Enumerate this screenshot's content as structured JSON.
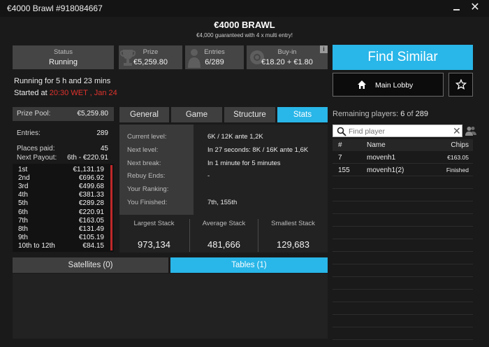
{
  "window": {
    "title": "€4000 Brawl #918084667"
  },
  "header": {
    "title": "€4000 BRAWL",
    "subtitle": "€4,000 guaranteed with 4 x multi entry!"
  },
  "tiles": [
    {
      "label": "Status",
      "value": "Running",
      "icon": ""
    },
    {
      "label": "Prize",
      "value": "€5,259.80",
      "icon": "trophy-icon"
    },
    {
      "label": "Entries",
      "value": "6/289",
      "icon": "person-icon"
    },
    {
      "label": "Buy-in",
      "value": "€18.20 + €1.80",
      "icon": "chip-icon"
    }
  ],
  "info_badge": "i",
  "status": {
    "running_prefix": "Running for",
    "running_value": "5 h and 23 mins",
    "started_prefix": "Started at",
    "started_value": "20:30 WET , Jan 24"
  },
  "actions": {
    "find_similar": "Find Similar",
    "main_lobby": "Main Lobby"
  },
  "players": {
    "remaining_label": "Remaining players:",
    "remaining_count": "6",
    "remaining_of": "of",
    "remaining_total": "289",
    "search_placeholder": "Find player",
    "columns": [
      "#",
      "Name",
      "Chips"
    ],
    "rows": [
      {
        "rank": "7",
        "name": "movenh1",
        "chips": "€163.05"
      },
      {
        "rank": "155",
        "name": "movenh1(2)",
        "chips": "Finished"
      }
    ]
  },
  "payout": {
    "pool_label": "Prize Pool:",
    "pool_value": "€5,259.80",
    "entries_label": "Entries:",
    "entries_value": "289",
    "places_label": "Places paid:",
    "places_value": "45",
    "next_label": "Next Payout:",
    "next_value": "6th - €220.91",
    "rows": [
      {
        "place": "1st",
        "amount": "€1,131.19"
      },
      {
        "place": "2nd",
        "amount": "€696.92"
      },
      {
        "place": "3rd",
        "amount": "€499.68"
      },
      {
        "place": "4th",
        "amount": "€381.33"
      },
      {
        "place": "5th",
        "amount": "€289.28"
      },
      {
        "place": "6th",
        "amount": "€220.91"
      },
      {
        "place": "7th",
        "amount": "€163.05"
      },
      {
        "place": "8th",
        "amount": "€131.49"
      },
      {
        "place": "9th",
        "amount": "€105.19"
      },
      {
        "place": "10th to 12th",
        "amount": "€84.15"
      }
    ]
  },
  "tabs": [
    "General",
    "Game",
    "Structure",
    "Stats"
  ],
  "stats": {
    "labels": [
      "Current level:",
      "Next level:",
      "Next break:",
      "Rebuy Ends:",
      "Your Ranking:",
      "You Finished:"
    ],
    "values": [
      "6K / 12K ante 1,2K",
      "In 27 seconds: 8K / 16K ante 1,6K",
      "In 1 minute for 5 minutes",
      "-",
      "",
      "7th, 155th"
    ],
    "stacks": [
      {
        "label": "Largest Stack",
        "value": "973,134"
      },
      {
        "label": "Average Stack",
        "value": "481,666"
      },
      {
        "label": "Smallest Stack",
        "value": "129,683"
      }
    ]
  },
  "bottom_tabs": [
    "Satellites (0)",
    "Tables (1)"
  ],
  "colors": {
    "accent": "#29b6e8",
    "danger": "#e0332d",
    "tile": "#454545",
    "background": "#1a1a1a"
  }
}
